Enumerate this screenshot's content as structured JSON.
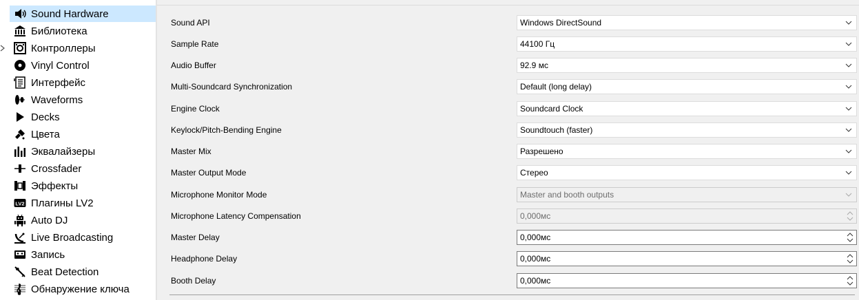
{
  "sidebar": {
    "items": [
      {
        "label": "Sound Hardware",
        "icon": "speaker-icon"
      },
      {
        "label": "Библиотека",
        "icon": "library-icon"
      },
      {
        "label": "Контроллеры",
        "icon": "controller-icon"
      },
      {
        "label": "Vinyl Control",
        "icon": "vinyl-icon"
      },
      {
        "label": "Интерфейс",
        "icon": "interface-icon"
      },
      {
        "label": "Waveforms",
        "icon": "waveform-icon"
      },
      {
        "label": "Decks",
        "icon": "play-icon"
      },
      {
        "label": "Цвета",
        "icon": "paint-icon"
      },
      {
        "label": "Эквалайзеры",
        "icon": "equalizer-icon"
      },
      {
        "label": "Crossfader",
        "icon": "crossfader-icon"
      },
      {
        "label": "Эффекты",
        "icon": "effects-icon"
      },
      {
        "label": "Плагины LV2",
        "icon": "lv2-icon"
      },
      {
        "label": "Auto DJ",
        "icon": "robot-icon"
      },
      {
        "label": "Live Broadcasting",
        "icon": "satellite-icon"
      },
      {
        "label": "Запись",
        "icon": "cassette-icon"
      },
      {
        "label": "Beat Detection",
        "icon": "metronome-icon"
      },
      {
        "label": "Обнаружение ключа",
        "icon": "treble-clef-icon"
      }
    ]
  },
  "settings": {
    "rows": [
      {
        "label": "Sound API",
        "value": "Windows DirectSound",
        "type": "select"
      },
      {
        "label": "Sample Rate",
        "value": "44100 Гц",
        "type": "select"
      },
      {
        "label": "Audio Buffer",
        "value": "92.9 мс",
        "type": "select"
      },
      {
        "label": "Multi-Soundcard Synchronization",
        "value": "Default (long delay)",
        "type": "select"
      },
      {
        "label": "Engine Clock",
        "value": "Soundcard Clock",
        "type": "select"
      },
      {
        "label": "Keylock/Pitch-Bending Engine",
        "value": "Soundtouch (faster)",
        "type": "select"
      },
      {
        "label": "Master Mix",
        "value": "Разрешено",
        "type": "select"
      },
      {
        "label": "Master Output Mode",
        "value": "Стерео",
        "type": "select"
      },
      {
        "label": "Microphone Monitor Mode",
        "value": "Master and booth outputs",
        "type": "select",
        "disabled": true
      },
      {
        "label": "Microphone Latency Compensation",
        "value": "0,000мс",
        "type": "spin",
        "disabled": true
      },
      {
        "label": "Master Delay",
        "value": "0,000мс",
        "type": "spin"
      },
      {
        "label": "Headphone Delay",
        "value": "0,000мс",
        "type": "spin"
      },
      {
        "label": "Booth Delay",
        "value": "0,000мс",
        "type": "spin"
      }
    ]
  },
  "colors": {
    "selection": "#cce8ff",
    "panel_bg": "#f0f0f0"
  }
}
